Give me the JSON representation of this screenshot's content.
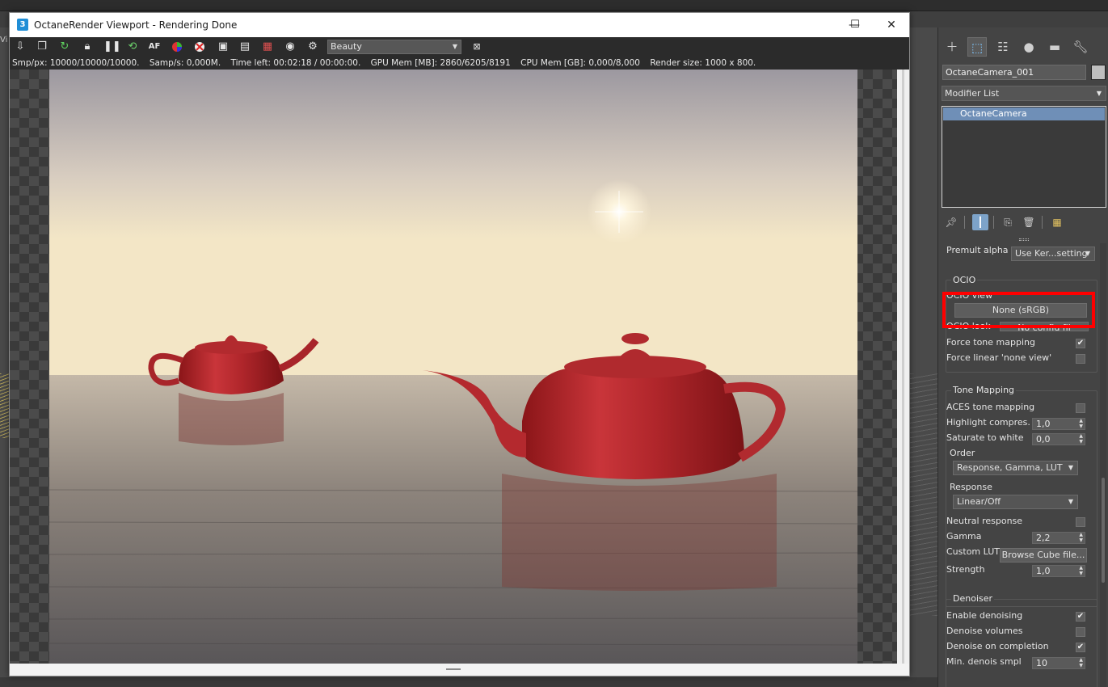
{
  "window": {
    "title": "OctaneRender Viewport - Rendering Done",
    "app_icon": "3",
    "buttons": {
      "minimize": "—",
      "maximize": "☐",
      "close": "✕"
    }
  },
  "background_label": "Vi",
  "toolbar": {
    "icons": [
      "export-icon",
      "copy-icon",
      "restart-icon",
      "lock-icon",
      "pause-icon",
      "refresh-icon",
      "af-icon",
      "color-picker-icon",
      "material-picker-icon",
      "region-render-icon",
      "film-region-icon",
      "render-layer-icon",
      "camera-icon",
      "settings-icon"
    ],
    "render_pass": "Beauty",
    "extra_icon": "image-icon"
  },
  "status": {
    "smp_px": "Smp/px: 10000/10000/10000.",
    "samp_s": "Samp/s: 0,000M.",
    "time_left": "Time left: 00:02:18 / 00:00:00.",
    "gpu_mem": "GPU Mem [MB]: 2860/6205/8191",
    "cpu_mem": "CPU Mem [GB]: 0,000/8,000",
    "render_size": "Render size: 1000 x 800."
  },
  "panel": {
    "tabs": [
      "create-icon",
      "modify-icon",
      "hierarchy-icon",
      "motion-icon",
      "display-icon",
      "utilities-icon"
    ],
    "object_name": "OctaneCamera_001",
    "modifier_list": "Modifier List",
    "stack_items": [
      "OctaneCamera"
    ],
    "premult_alpha": {
      "label": "Premult alpha",
      "value": "Use Ker...setting"
    },
    "ocio": {
      "title": "OCIO",
      "view_label": "OCIO view",
      "view_value": "None (sRGB)",
      "look_label": "OCIO look",
      "look_value": "No config fil",
      "force_tone_mapping": {
        "label": "Force tone mapping",
        "checked": true
      },
      "force_linear": {
        "label": "Force linear 'none view'",
        "checked": false
      }
    },
    "tone_mapping": {
      "title": "Tone Mapping",
      "aces": {
        "label": "ACES tone mapping",
        "checked": false
      },
      "highlight": {
        "label": "Highlight compres.",
        "value": "1,0"
      },
      "saturate": {
        "label": "Saturate to white",
        "value": "0,0"
      },
      "order_label": "Order",
      "order_value": "Response, Gamma, LUT",
      "response_label": "Response",
      "response_value": "Linear/Off",
      "neutral": {
        "label": "Neutral response",
        "checked": false
      },
      "gamma": {
        "label": "Gamma",
        "value": "2,2"
      },
      "custom_lut_label": "Custom LUT",
      "custom_lut_button": "Browse Cube file...",
      "strength": {
        "label": "Strength",
        "value": "1,0"
      }
    },
    "denoiser": {
      "title": "Denoiser",
      "enable": {
        "label": "Enable denoising",
        "checked": true
      },
      "volumes": {
        "label": "Denoise volumes",
        "checked": false
      },
      "on_completion": {
        "label": "Denoise on completion",
        "checked": true
      },
      "min_smpl": {
        "label": "Min. denois smpl",
        "value": "10"
      }
    }
  }
}
